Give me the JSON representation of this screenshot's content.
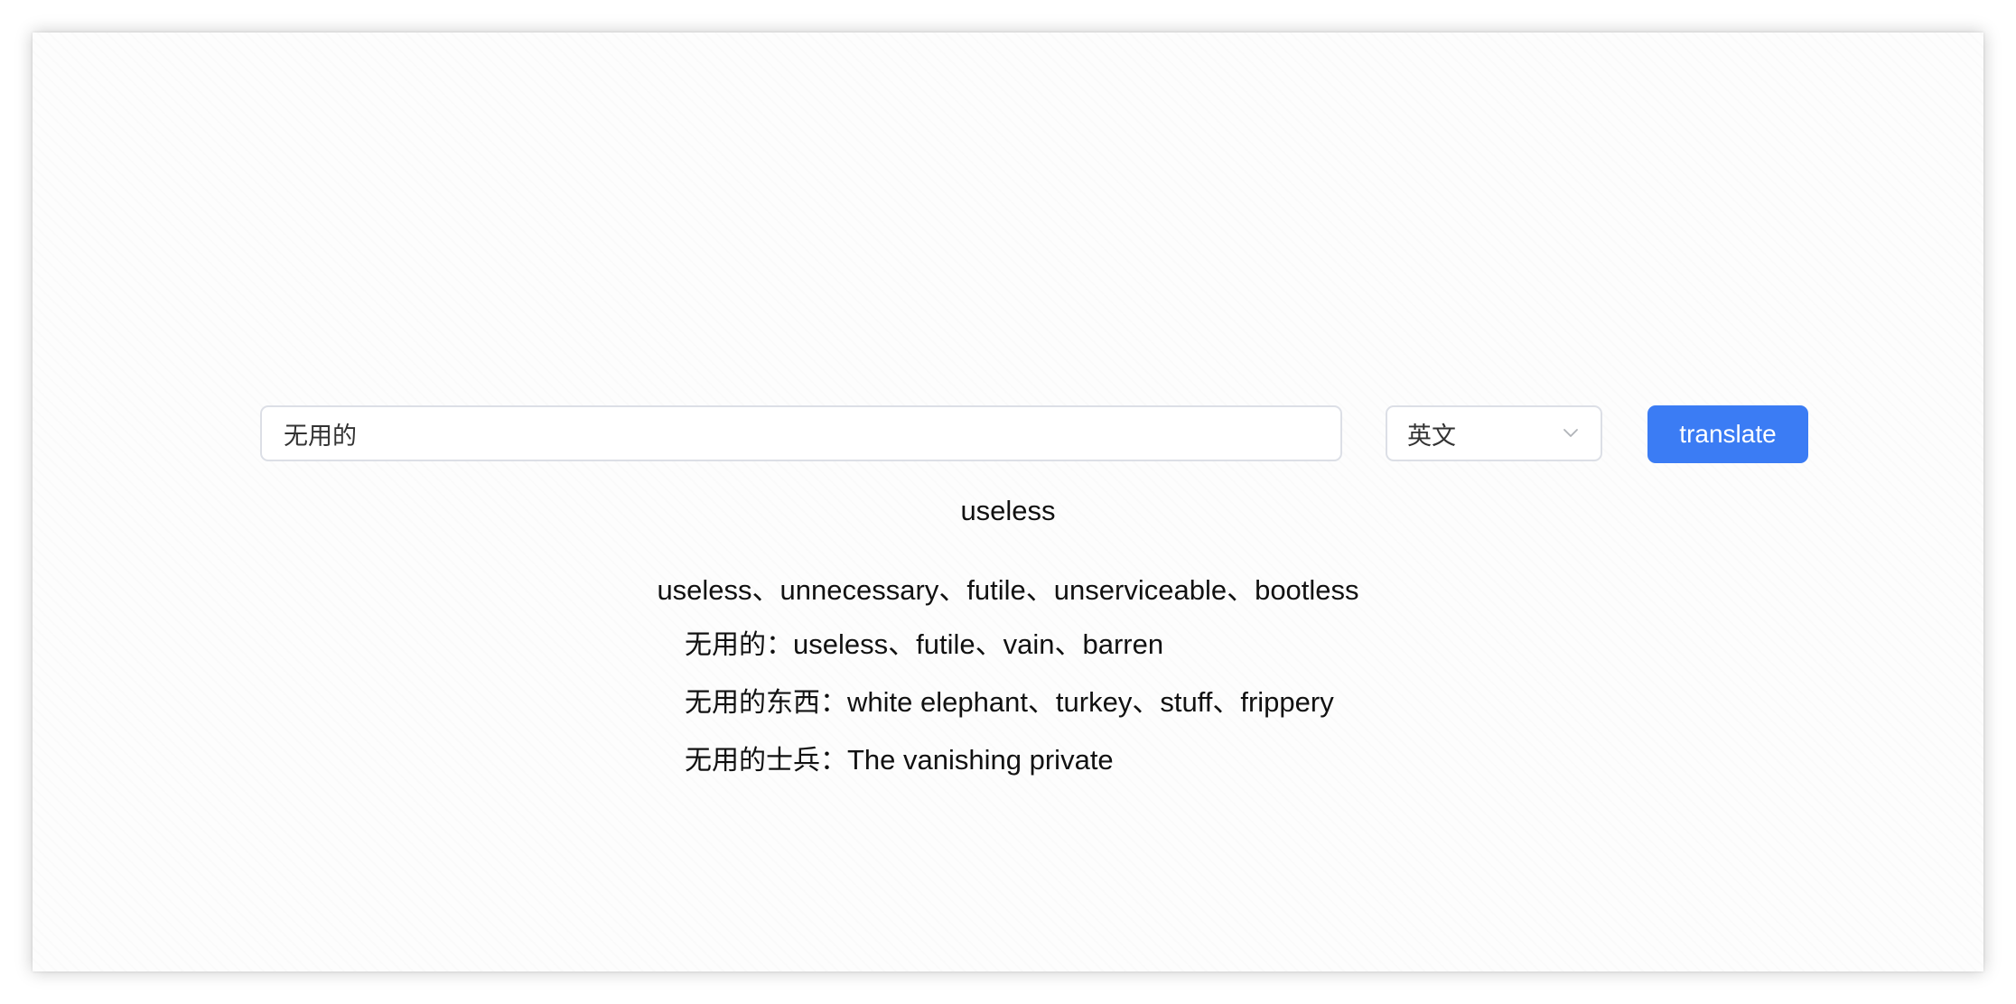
{
  "input": {
    "value": "无用的"
  },
  "language_select": {
    "selected": "英文",
    "icon": "chevron-down-icon"
  },
  "translate_button": {
    "label": "translate",
    "color": "#3b7cf4"
  },
  "result": {
    "main": "useless",
    "synonyms": "useless、unnecessary、futile、unserviceable、bootless",
    "phrases": [
      {
        "key": "无用的：",
        "value": "useless、futile、vain、barren"
      },
      {
        "key": "无用的东西：",
        "value": "white elephant、turkey、stuff、frippery"
      },
      {
        "key": "无用的士兵：",
        "value": "The vanishing private"
      }
    ]
  }
}
